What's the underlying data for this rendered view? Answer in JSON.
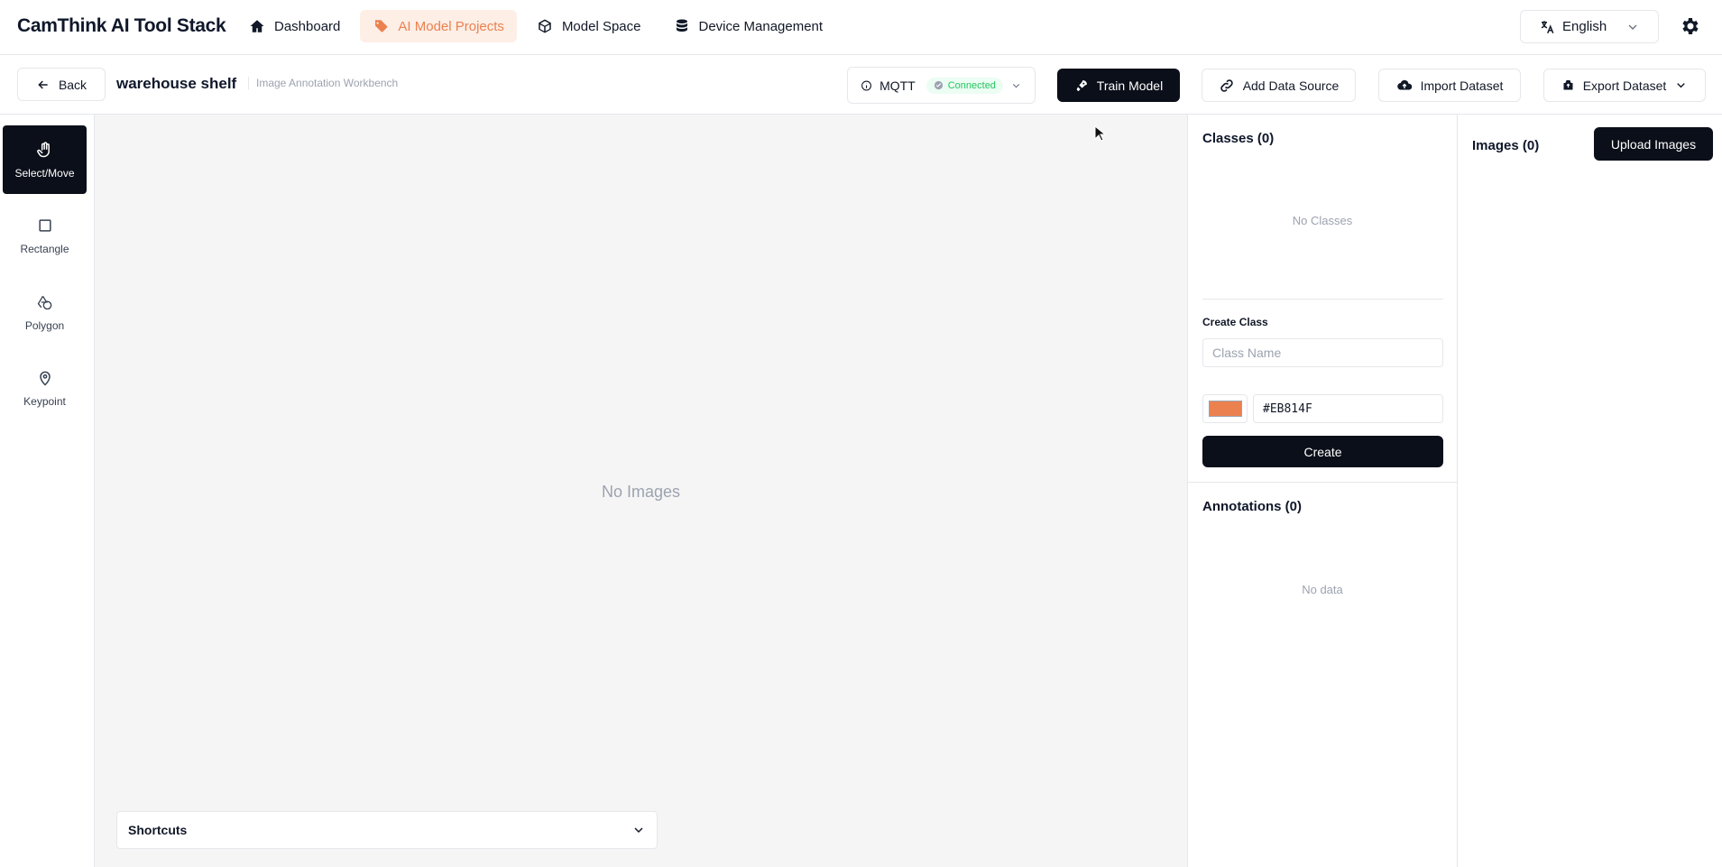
{
  "app": {
    "brand": "CamThink AI Tool Stack"
  },
  "nav": {
    "items": [
      {
        "label": "Dashboard",
        "icon": "home-icon",
        "active": false
      },
      {
        "label": "AI Model Projects",
        "icon": "tag-icon",
        "active": true
      },
      {
        "label": "Model Space",
        "icon": "box-icon",
        "active": false
      },
      {
        "label": "Device Management",
        "icon": "database-icon",
        "active": false
      }
    ],
    "language": "English"
  },
  "toolbar": {
    "back_label": "Back",
    "project_title": "warehouse shelf",
    "project_subtitle": "Image Annotation Workbench",
    "mqtt_label": "MQTT",
    "mqtt_status": "Connected",
    "train_label": "Train Model",
    "add_source_label": "Add Data Source",
    "import_label": "Import Dataset",
    "export_label": "Export Dataset"
  },
  "tools": [
    {
      "label": "Select/Move",
      "icon": "hand-icon",
      "active": true
    },
    {
      "label": "Rectangle",
      "icon": "square-icon",
      "active": false
    },
    {
      "label": "Polygon",
      "icon": "polygon-icon",
      "active": false
    },
    {
      "label": "Keypoint",
      "icon": "map-pin-icon",
      "active": false
    }
  ],
  "canvas": {
    "empty_text": "No Images",
    "shortcuts_label": "Shortcuts"
  },
  "classes": {
    "title": "Classes (0)",
    "empty_text": "No Classes",
    "create_title": "Create Class",
    "name_placeholder": "Class Name",
    "color_value": "#EB814F",
    "create_button": "Create"
  },
  "annotations": {
    "title": "Annotations (0)",
    "empty_text": "No data"
  },
  "images": {
    "title": "Images (0)",
    "upload_button": "Upload Images"
  },
  "colors": {
    "accent": "#EB814F",
    "dark": "#0B0F19",
    "status_ok": "#22C55E"
  }
}
